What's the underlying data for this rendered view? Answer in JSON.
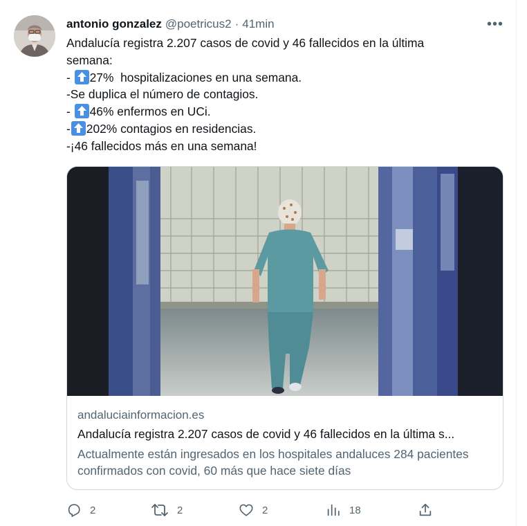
{
  "tweet": {
    "author_name": "antonio gonzalez",
    "author_handle": "@poetricus2",
    "separator": "·",
    "time": "41min",
    "more_label": "•••",
    "lines": [
      {
        "prefix": "Andalucía registra 2.207 casos de covid y 46 fallecidos en la última",
        "emoji": false,
        "suffix": ""
      },
      {
        "prefix": "semana:",
        "emoji": false,
        "suffix": ""
      },
      {
        "prefix": "- ",
        "emoji": true,
        "suffix": "27%  hospitalizaciones en una semana."
      },
      {
        "prefix": "-Se duplica el número de contagios.",
        "emoji": false,
        "suffix": ""
      },
      {
        "prefix": "- ",
        "emoji": true,
        "suffix": "46% enfermos en UCi."
      },
      {
        "prefix": "-",
        "emoji": true,
        "suffix": "202% contagios en residencias."
      },
      {
        "prefix": "-¡46 fallecidos más en una semana!",
        "emoji": false,
        "suffix": ""
      }
    ],
    "emoji_icon": "up-arrow-emoji-icon"
  },
  "card": {
    "domain": "andaluciainformacion.es",
    "title": "Andalucía registra 2.207 casos de covid y 46 fallecidos en la última s...",
    "description": "Actualmente están ingresados en los hospitales andaluces 284 pacientes confirmados con covid, 60 más que hace siete días"
  },
  "actions": {
    "reply": {
      "icon": "reply-icon",
      "count": "2"
    },
    "retweet": {
      "icon": "retweet-icon",
      "count": "2"
    },
    "like": {
      "icon": "heart-icon",
      "count": "2"
    },
    "views": {
      "icon": "views-icon",
      "count": "18"
    },
    "share": {
      "icon": "share-icon"
    }
  },
  "colors": {
    "text_primary": "#0f1419",
    "text_secondary": "#536471",
    "border": "#cfd9de",
    "emoji_blue": "#4a90e2"
  }
}
